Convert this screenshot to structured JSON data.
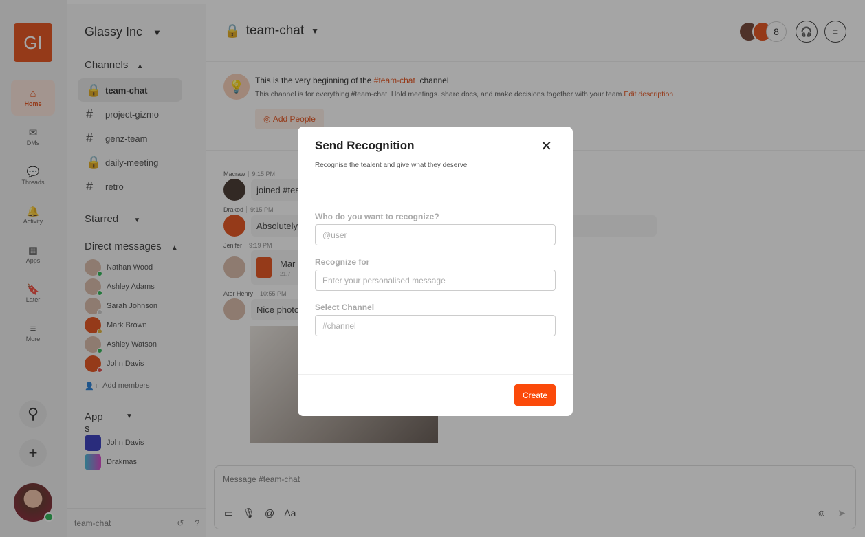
{
  "rail": {
    "logo": "GI",
    "items": [
      {
        "label": "Home",
        "icon": "home-icon",
        "g": "⌂"
      },
      {
        "label": "DMs",
        "icon": "dm-icon",
        "g": "✉"
      },
      {
        "label": "Threads",
        "icon": "threads-icon",
        "g": "💬"
      },
      {
        "label": "Activity",
        "icon": "bell-icon",
        "g": "🔔"
      },
      {
        "label": "Apps",
        "icon": "apps-icon",
        "g": "▦"
      },
      {
        "label": "Later",
        "icon": "bookmark-icon",
        "g": "🔖"
      },
      {
        "label": "More",
        "icon": "menu-icon",
        "g": "≡"
      }
    ]
  },
  "sidebar": {
    "workspace": "Glassy Inc",
    "channels_label": "Channels",
    "channels": [
      {
        "name": "team-chat",
        "icon": "lock"
      },
      {
        "name": "project-gizmo",
        "icon": "hash"
      },
      {
        "name": "genz-team",
        "icon": "hash"
      },
      {
        "name": "daily-meeting",
        "icon": "lock"
      },
      {
        "name": "retro",
        "icon": "hash"
      }
    ],
    "starred_label": "Starred",
    "dm_label": "Direct messages",
    "dms": [
      "Nathan Wood",
      "Ashley Adams",
      "Sarah Johnson",
      "Mark Brown",
      "Ashley Watson",
      "John Davis"
    ],
    "add_members": "Add members",
    "apps_label": "App\ns",
    "apps": [
      "John Davis",
      "Drakmas"
    ],
    "footer": "team-chat"
  },
  "header": {
    "channel": "team-chat",
    "member_count": "8"
  },
  "intro": {
    "title_pre": "This is the very beginning of the ",
    "title_channel": "#team-chat",
    "title_post": "  channel",
    "desc": "This channel is for everything #team-chat. Hold meetings. share docs, and make decisions together with your team.",
    "edit": "Edit description",
    "add_people": "Add People"
  },
  "messages": [
    {
      "user": "Macraw",
      "time": "9:15 PM",
      "text": "joined #team-chat"
    },
    {
      "user": "Drakod",
      "time": "9:15 PM",
      "text": "Absolutely, ... er along the way."
    },
    {
      "user": "Jenifer",
      "time": "9:19 PM",
      "file": "Mar",
      "size": "21.7"
    },
    {
      "user": "Ater Henry",
      "time": "10:55 PM",
      "text": "Nice photo"
    }
  ],
  "composer": {
    "placeholder": "Message #team-chat"
  },
  "modal": {
    "title": "Send Recognition",
    "subtitle": "Recognise the tealent and give what they deserve",
    "fields": [
      {
        "label": "Who do you want to recognize?",
        "placeholder": "@user"
      },
      {
        "label": "Recognize for",
        "placeholder": "Enter your personalised message"
      },
      {
        "label": "Select Channel",
        "placeholder": "#channel"
      }
    ],
    "create": "Create"
  },
  "colors": {
    "accent": "#e4470f",
    "button": "#fb4a0a"
  }
}
